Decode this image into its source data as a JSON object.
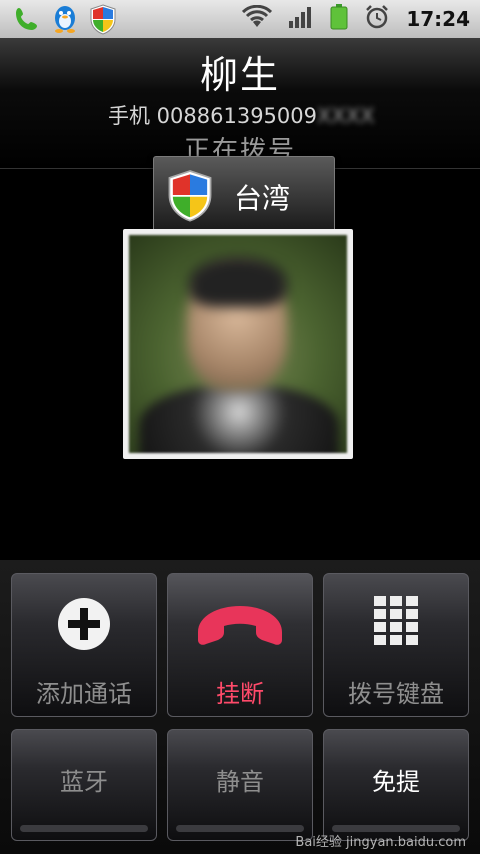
{
  "status_bar": {
    "icons": [
      "phone-in-call-icon",
      "qq-penguin-icon",
      "security-shield-icon",
      "wifi-icon",
      "signal-icon",
      "battery-icon",
      "alarm-clock-icon"
    ],
    "time": "17:24"
  },
  "caller": {
    "name": "柳生",
    "number_prefix": "手机 008861395009",
    "number_hidden": "XXXX",
    "status": "正在拨号",
    "location": "台湾"
  },
  "buttons": {
    "add_call": "添加通话",
    "hang_up": "挂断",
    "dialpad": "拨号键盘",
    "bluetooth": "蓝牙",
    "mute": "静音",
    "speaker": "免提"
  },
  "colors": {
    "hangup_red": "#e8355a",
    "accent_label_red": "#ff4a6a"
  },
  "watermark": "Bai经验 jingyan.baidu.com"
}
